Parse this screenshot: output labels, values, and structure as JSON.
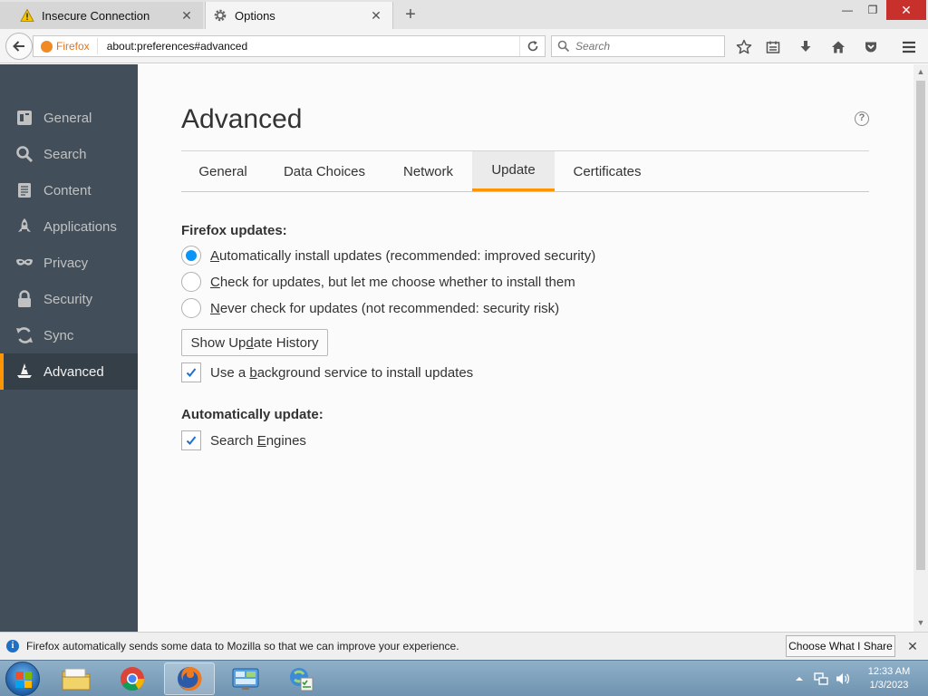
{
  "tabs": [
    {
      "title": "Insecure Connection",
      "icon": "warning-icon"
    },
    {
      "title": "Options",
      "icon": "gear-icon"
    }
  ],
  "new_tab_glyph": "+",
  "window_controls": {
    "minimize": "—",
    "maximize": "❐",
    "close": "✕"
  },
  "navbar": {
    "identity_label": "Firefox",
    "url": "about:preferences#advanced",
    "search_placeholder": "Search"
  },
  "sidebar": {
    "items": [
      {
        "label": "General",
        "icon": "general-icon"
      },
      {
        "label": "Search",
        "icon": "search-icon"
      },
      {
        "label": "Content",
        "icon": "content-icon"
      },
      {
        "label": "Applications",
        "icon": "applications-icon"
      },
      {
        "label": "Privacy",
        "icon": "privacy-mask-icon"
      },
      {
        "label": "Security",
        "icon": "security-lock-icon"
      },
      {
        "label": "Sync",
        "icon": "sync-icon"
      },
      {
        "label": "Advanced",
        "icon": "advanced-wizard-hat-icon",
        "selected": true
      }
    ]
  },
  "main": {
    "title": "Advanced",
    "help_glyph": "?",
    "tabs": [
      "General",
      "Data Choices",
      "Network",
      "Update",
      "Certificates"
    ],
    "active_tab": "Update",
    "updates": {
      "heading": "Firefox updates:",
      "options": [
        {
          "accesskey": "A",
          "rest": "utomatically install updates (recommended: improved security)",
          "selected": true
        },
        {
          "accesskey": "C",
          "rest": "heck for updates, but let me choose whether to install them",
          "selected": false
        },
        {
          "accesskey": "N",
          "rest": "ever check for updates (not recommended: security risk)",
          "selected": false
        }
      ],
      "history_button": {
        "before": "Show Up",
        "accesskey": "d",
        "after": "ate History"
      },
      "background_service": {
        "before": "Use a ",
        "accesskey": "b",
        "after": "ackground service to install updates",
        "checked": true
      }
    },
    "auto_update": {
      "heading": "Automatically update:",
      "search_engines": {
        "before": "Search ",
        "accesskey": "E",
        "after": "ngines",
        "checked": true
      }
    }
  },
  "notification": {
    "text": "Firefox automatically sends some data to Mozilla so that we can improve your experience.",
    "button": "Choose What I Share",
    "close_glyph": "✕"
  },
  "taskbar": {
    "apps": [
      "start-orb",
      "file-explorer",
      "chrome",
      "firefox",
      "control-panel",
      "windows-update"
    ],
    "time": "12:33 AM",
    "date": "1/3/2023"
  },
  "colors": {
    "accent": "#ff9500",
    "radio_blue": "#0996f8",
    "sidebar_bg": "#424f5a",
    "sidebar_selected_bg": "#343f48"
  }
}
